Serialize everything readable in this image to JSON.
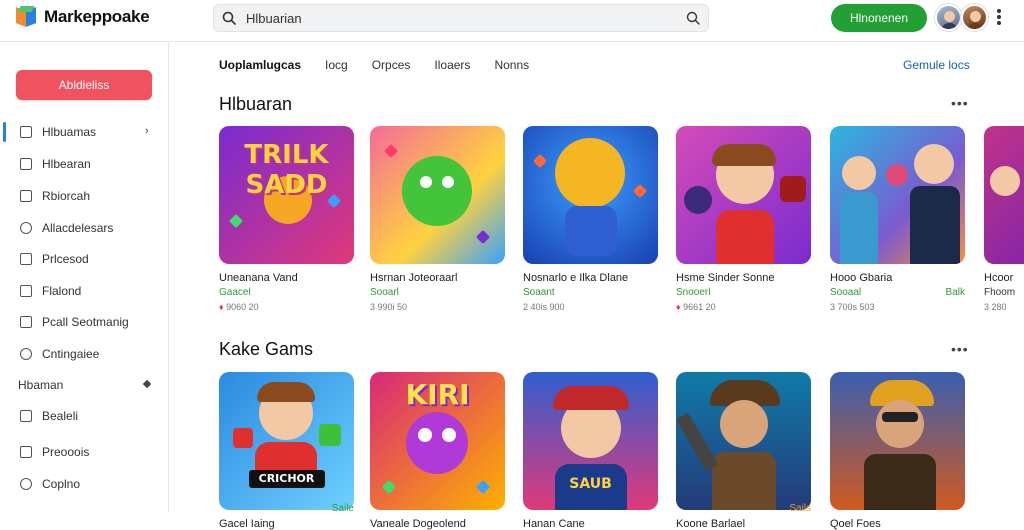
{
  "header": {
    "app_name": "Markeppoake",
    "search_value": "Hlbuarian",
    "cta_label": "Hlnonenen"
  },
  "sidebar": {
    "cta_label": "Abldieliss",
    "items": [
      {
        "label": "Hlbuamas",
        "active": true,
        "chevron": "›"
      },
      {
        "label": "Hlbearan"
      },
      {
        "label": "Rbiorcah"
      },
      {
        "label": "Allacdelesars"
      },
      {
        "label": "Prlcesod"
      },
      {
        "label": "Flalond"
      },
      {
        "label": "Pcall Seotmanig"
      },
      {
        "label": "Cntingaiee"
      }
    ],
    "section_label": "Hbaman",
    "section_items": [
      {
        "label": "Bealeli"
      },
      {
        "label": "Preooois"
      },
      {
        "label": "Coplno"
      }
    ]
  },
  "tabs": [
    "Uoplamlugcas",
    "Iocg",
    "Orpces",
    "Iloaers",
    "Nonns"
  ],
  "browse_link": "Gemule locs",
  "sections": [
    {
      "title": "Hlbuaran",
      "more": "•••",
      "cards": [
        {
          "art_text": "TRILK SADD",
          "title": "Uneanana Vand",
          "subtitle": "Gaacel",
          "meta": "9060 20",
          "heart": true,
          "colors": [
            "#7a2bd0",
            "#e0397a"
          ]
        },
        {
          "art_text": "",
          "title": "Hsrnan Joteoraarl",
          "subtitle": "Sooarl",
          "meta": "3 990i 50",
          "heart": false,
          "colors": [
            "#f46b9a",
            "#ffd23f"
          ]
        },
        {
          "art_text": "",
          "title": "Nosnarlo e Ilka Dlane",
          "subtitle": "Soaant",
          "meta": "2 40is 900",
          "heart": false,
          "colors": [
            "#1a5bd8",
            "#3aa0ff"
          ]
        },
        {
          "art_text": "",
          "title": "Hsme Sinder Sonne",
          "subtitle": "Snooerl",
          "meta": "9661 20",
          "heart": true,
          "colors": [
            "#d64bb8",
            "#7a2bd0"
          ]
        },
        {
          "art_text": "",
          "title": "Hooo Gbaria",
          "subtitle": "Sooaal",
          "meta": "3 700s 503",
          "heart": false,
          "tag": "Balk",
          "colors": [
            "#2bb7e0",
            "#ff8c3a"
          ]
        },
        {
          "art_text": "",
          "title": "Hcoor",
          "subtitle": "Fhoom",
          "meta": "3 280",
          "heart": false,
          "colors": [
            "#c0338a",
            "#6a1fb5"
          ]
        }
      ]
    },
    {
      "title": "Kake Gams",
      "more": "•••",
      "cards": [
        {
          "art_text": "CRICHOR",
          "title": "Gacel Iaing",
          "tag": "Saile",
          "colors": [
            "#2a8ae0",
            "#6fd0ff"
          ]
        },
        {
          "art_text": "KIRI",
          "title": "Vaneale Dogeolend",
          "colors": [
            "#d8287a",
            "#ffb000"
          ]
        },
        {
          "art_text": "SAUB",
          "title": "Hanan Cane",
          "colors": [
            "#2f5fd0",
            "#e0397a"
          ]
        },
        {
          "art_text": "",
          "title": "Koone Barlael",
          "tag": "Sails",
          "colors": [
            "#0f7ba8",
            "#243a7a"
          ]
        },
        {
          "art_text": "",
          "title": "Qoel Foes",
          "colors": [
            "#3a5fb0",
            "#d05a1f"
          ]
        }
      ]
    }
  ]
}
